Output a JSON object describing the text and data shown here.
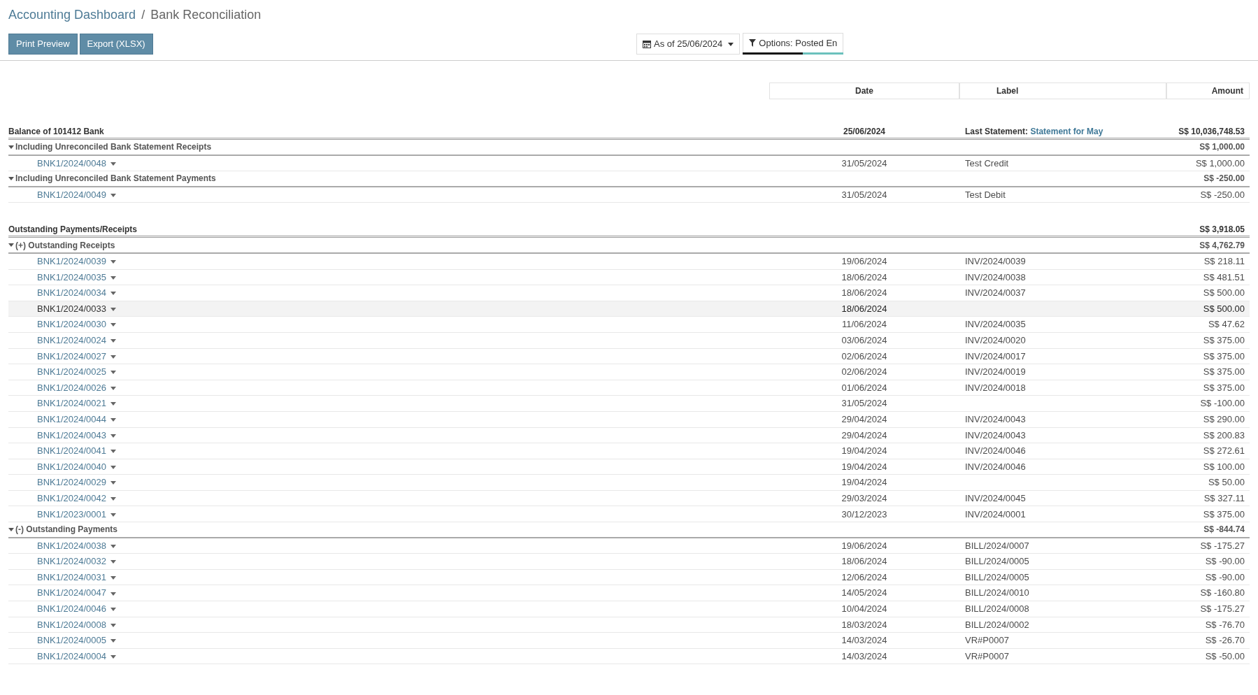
{
  "breadcrumb": [
    "Accounting Dashboard",
    "Bank Reconciliation"
  ],
  "breadcrumb_separator": "/",
  "buttons": [
    "Print Preview",
    "Export (XLSX)"
  ],
  "date_filter": "As of 25/06/2024",
  "options_filter": "Options: Posted En",
  "columns": [
    "Date",
    "Label",
    "Amount"
  ],
  "sections": [
    {
      "title": "Balance of 101412 Bank",
      "date": "25/06/2024",
      "label_prefix": "Last Statement:",
      "label_link": "Statement for May",
      "amount": "S$ 10,036,748.53",
      "groups": [
        {
          "title": "Including Unreconciled Bank Statement Receipts",
          "expanded": true,
          "amount": "S$ 1,000.00",
          "lines": [
            {
              "ref": "BNK1/2024/0048",
              "date": "31/05/2024",
              "label": "Test Credit",
              "amount": "S$ 1,000.00",
              "highlighted": false
            }
          ]
        },
        {
          "title": "Including Unreconciled Bank Statement Payments",
          "expanded": true,
          "amount": "S$ -250.00",
          "lines": [
            {
              "ref": "BNK1/2024/0049",
              "date": "31/05/2024",
              "label": "Test Debit",
              "amount": "S$ -250.00",
              "highlighted": false
            }
          ]
        }
      ]
    },
    {
      "title": "Outstanding Payments/Receipts",
      "amount": "S$ 3,918.05",
      "groups": [
        {
          "title": "(+) Outstanding Receipts",
          "expanded": true,
          "amount": "S$ 4,762.79",
          "lines": [
            {
              "ref": "BNK1/2024/0039",
              "date": "19/06/2024",
              "label": "INV/2024/0039",
              "amount": "S$ 218.11",
              "highlighted": false
            },
            {
              "ref": "BNK1/2024/0035",
              "date": "18/06/2024",
              "label": "INV/2024/0038",
              "amount": "S$ 481.51",
              "highlighted": false
            },
            {
              "ref": "BNK1/2024/0034",
              "date": "18/06/2024",
              "label": "INV/2024/0037",
              "amount": "S$ 500.00",
              "highlighted": false
            },
            {
              "ref": "BNK1/2024/0033",
              "date": "18/06/2024",
              "amount": "S$ 500.00",
              "highlighted": true
            },
            {
              "ref": "BNK1/2024/0030",
              "date": "11/06/2024",
              "label": "INV/2024/0035",
              "amount": "S$ 47.62",
              "highlighted": false
            },
            {
              "ref": "BNK1/2024/0024",
              "date": "03/06/2024",
              "label": "INV/2024/0020",
              "amount": "S$ 375.00",
              "highlighted": false
            },
            {
              "ref": "BNK1/2024/0027",
              "date": "02/06/2024",
              "label": "INV/2024/0017",
              "amount": "S$ 375.00",
              "highlighted": false
            },
            {
              "ref": "BNK1/2024/0025",
              "date": "02/06/2024",
              "label": "INV/2024/0019",
              "amount": "S$ 375.00",
              "highlighted": false
            },
            {
              "ref": "BNK1/2024/0026",
              "date": "01/06/2024",
              "label": "INV/2024/0018",
              "amount": "S$ 375.00",
              "highlighted": false
            },
            {
              "ref": "BNK1/2024/0021",
              "date": "31/05/2024",
              "amount": "S$ -100.00",
              "highlighted": false
            },
            {
              "ref": "BNK1/2024/0044",
              "date": "29/04/2024",
              "label": "INV/2024/0043",
              "amount": "S$ 290.00",
              "highlighted": false
            },
            {
              "ref": "BNK1/2024/0043",
              "date": "29/04/2024",
              "label": "INV/2024/0043",
              "amount": "S$ 200.83",
              "highlighted": false
            },
            {
              "ref": "BNK1/2024/0041",
              "date": "19/04/2024",
              "label": "INV/2024/0046",
              "amount": "S$ 272.61",
              "highlighted": false
            },
            {
              "ref": "BNK1/2024/0040",
              "date": "19/04/2024",
              "label": "INV/2024/0046",
              "amount": "S$ 100.00",
              "highlighted": false
            },
            {
              "ref": "BNK1/2024/0029",
              "date": "19/04/2024",
              "amount": "S$ 50.00",
              "highlighted": false
            },
            {
              "ref": "BNK1/2024/0042",
              "date": "29/03/2024",
              "label": "INV/2024/0045",
              "amount": "S$ 327.11",
              "highlighted": false
            },
            {
              "ref": "BNK1/2023/0001",
              "date": "30/12/2023",
              "label": "INV/2024/0001",
              "amount": "S$ 375.00",
              "highlighted": false
            }
          ]
        },
        {
          "title": "(-) Outstanding Payments",
          "expanded": true,
          "amount": "S$ -844.74",
          "lines": [
            {
              "ref": "BNK1/2024/0038",
              "date": "19/06/2024",
              "label": "BILL/2024/0007",
              "amount": "S$ -175.27",
              "highlighted": false
            },
            {
              "ref": "BNK1/2024/0032",
              "date": "18/06/2024",
              "label": "BILL/2024/0005",
              "amount": "S$ -90.00",
              "highlighted": false
            },
            {
              "ref": "BNK1/2024/0031",
              "date": "12/06/2024",
              "label": "BILL/2024/0005",
              "amount": "S$ -90.00",
              "highlighted": false
            },
            {
              "ref": "BNK1/2024/0047",
              "date": "14/05/2024",
              "label": "BILL/2024/0010",
              "amount": "S$ -160.80",
              "highlighted": false
            },
            {
              "ref": "BNK1/2024/0046",
              "date": "10/04/2024",
              "label": "BILL/2024/0008",
              "amount": "S$ -175.27",
              "highlighted": false
            },
            {
              "ref": "BNK1/2024/0008",
              "date": "18/03/2024",
              "label": "BILL/2024/0002",
              "amount": "S$ -76.70",
              "highlighted": false
            },
            {
              "ref": "BNK1/2024/0005",
              "date": "14/03/2024",
              "label": "VR#P0007",
              "amount": "S$ -26.70",
              "highlighted": false
            },
            {
              "ref": "BNK1/2024/0004",
              "date": "14/03/2024",
              "label": "VR#P0007",
              "amount": "S$ -50.00",
              "highlighted": false
            }
          ]
        }
      ]
    }
  ]
}
